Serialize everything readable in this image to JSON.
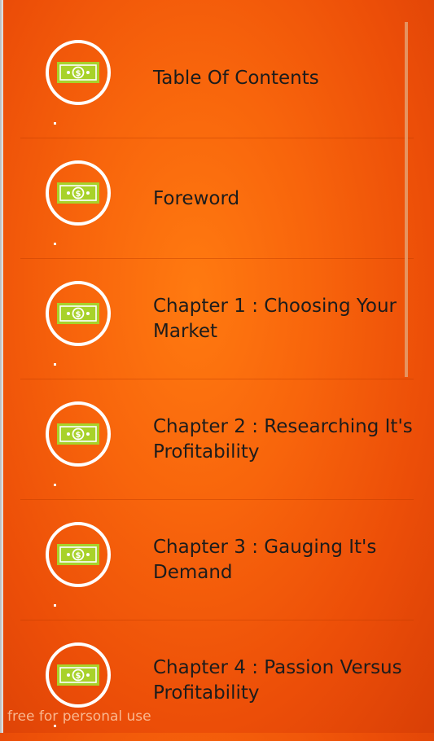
{
  "chapters": [
    {
      "title": "Table Of Contents",
      "icon": "money-bill-icon"
    },
    {
      "title": "Foreword",
      "icon": "money-bill-icon"
    },
    {
      "title": "Chapter 1 : Choosing Your Market",
      "icon": "money-bill-icon"
    },
    {
      "title": "Chapter 2 : Researching It's Profitability",
      "icon": "money-bill-icon"
    },
    {
      "title": "Chapter 3 : Gauging It's Demand",
      "icon": "money-bill-icon"
    },
    {
      "title": "Chapter 4 : Passion Versus Profitability",
      "icon": "money-bill-icon"
    }
  ],
  "watermark": "free for personal use",
  "colors": {
    "background_center": "#ff7a10",
    "background_edge": "#d93f06",
    "bill_green": "#a8d22a",
    "text": "#1c1c1c"
  }
}
